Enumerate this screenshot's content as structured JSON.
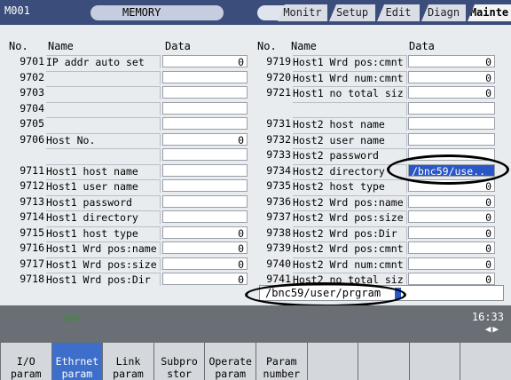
{
  "topbar": {
    "mode_id": "M001",
    "status": "MEMORY",
    "tabs": [
      "Monitr",
      "Setup",
      "Edit",
      "Diagn",
      "Mainte"
    ],
    "active_tab": "Mainte"
  },
  "table_headers": {
    "left": {
      "no": "No.",
      "name": "Name",
      "data": "Data"
    },
    "right": {
      "no": "No.",
      "name": "Name",
      "data": "Data"
    }
  },
  "left_rows": [
    {
      "no": "9701",
      "name": "IP addr auto set",
      "data": "0"
    },
    {
      "no": "9702",
      "name": "",
      "data": ""
    },
    {
      "no": "9703",
      "name": "",
      "data": ""
    },
    {
      "no": "9704",
      "name": "",
      "data": ""
    },
    {
      "no": "9705",
      "name": "",
      "data": ""
    },
    {
      "no": "9706",
      "name": "Host No.",
      "data": "0"
    },
    {
      "no": "",
      "name": "",
      "data": ""
    },
    {
      "no": "9711",
      "name": "Host1 host name",
      "data": ""
    },
    {
      "no": "9712",
      "name": "Host1 user name",
      "data": ""
    },
    {
      "no": "9713",
      "name": "Host1 password",
      "data": ""
    },
    {
      "no": "9714",
      "name": "Host1 directory",
      "data": ""
    },
    {
      "no": "9715",
      "name": "Host1 host type",
      "data": "0"
    },
    {
      "no": "9716",
      "name": "Host1 Wrd pos:name",
      "data": "0"
    },
    {
      "no": "9717",
      "name": "Host1 Wrd pos:size",
      "data": "0"
    },
    {
      "no": "9718",
      "name": "Host1 Wrd pos:Dir",
      "data": "0"
    }
  ],
  "right_rows": [
    {
      "no": "9719",
      "name": "Host1 Wrd pos:cmnt",
      "data": "0"
    },
    {
      "no": "9720",
      "name": "Host1 Wrd num:cmnt",
      "data": "0"
    },
    {
      "no": "9721",
      "name": "Host1 no total siz",
      "data": "0"
    },
    {
      "no": "",
      "name": "",
      "data": ""
    },
    {
      "no": "9731",
      "name": "Host2 host name",
      "data": ""
    },
    {
      "no": "9732",
      "name": "Host2 user name",
      "data": ""
    },
    {
      "no": "9733",
      "name": "Host2 password",
      "data": ""
    },
    {
      "no": "9734",
      "name": "Host2 directory",
      "data": "/bnc59/use.."
    },
    {
      "no": "9735",
      "name": "Host2 host type",
      "data": "0"
    },
    {
      "no": "9736",
      "name": "Host2 Wrd pos:name",
      "data": "0"
    },
    {
      "no": "9737",
      "name": "Host2 Wrd pos:size",
      "data": "0"
    },
    {
      "no": "9738",
      "name": "Host2 Wrd pos:Dir",
      "data": "0"
    },
    {
      "no": "9739",
      "name": "Host2 Wrd pos:cmnt",
      "data": "0"
    },
    {
      "no": "9740",
      "name": "Host2 Wrd num:cmnt",
      "data": "0"
    },
    {
      "no": "9741",
      "name": "Host2 no total siz",
      "data": "0"
    }
  ],
  "input_line": {
    "value": "/bnc59/user/prgram"
  },
  "message_bar": {
    "status": "RDY",
    "time": "16:33",
    "arrows": "◀▶"
  },
  "softkeys": [
    {
      "l1": "I/O",
      "l2": "param"
    },
    {
      "l1": "Ethrnet",
      "l2": "param"
    },
    {
      "l1": "Link",
      "l2": "param"
    },
    {
      "l1": "Subpro",
      "l2": "stor"
    },
    {
      "l1": "Operate",
      "l2": "param"
    },
    {
      "l1": "Param",
      "l2": "number"
    },
    {
      "l1": "",
      "l2": ""
    },
    {
      "l1": "",
      "l2": ""
    },
    {
      "l1": "",
      "l2": ""
    },
    {
      "l1": "",
      "l2": ""
    }
  ],
  "active_softkey": 1,
  "colors": {
    "topbar": "#3b4d7a",
    "selected": "#2a56c6",
    "softkey_active": "#3d6ec9",
    "rdy": "#3c8a3c"
  }
}
